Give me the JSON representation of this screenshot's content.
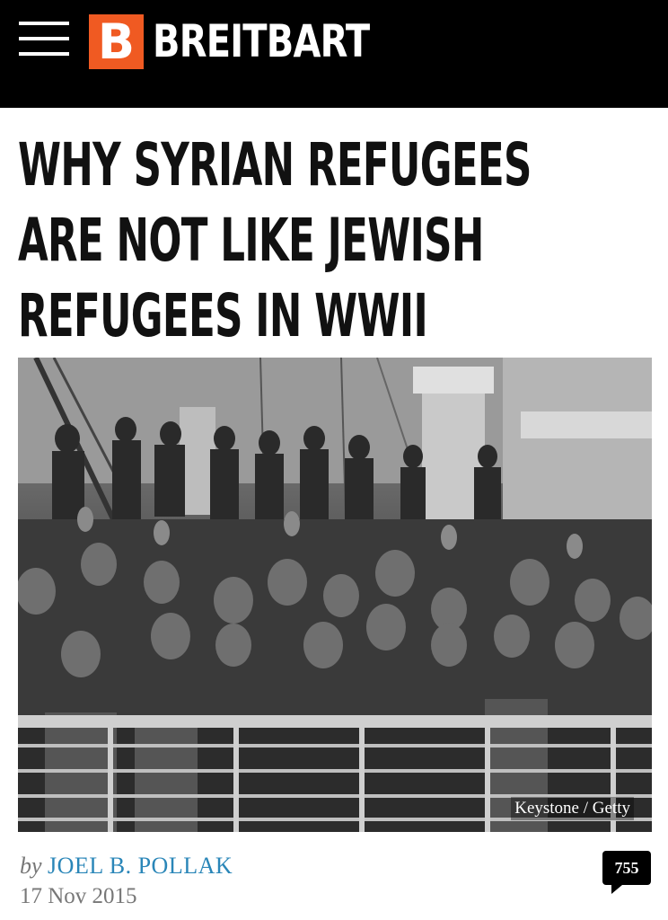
{
  "header": {
    "menu_icon": "hamburger-menu-icon",
    "logo_letter": "B",
    "logo_text": "BREITBART",
    "logo_color": "#f05a22"
  },
  "article": {
    "headline_lines": [
      "WHY SYRIAN REFUGEES",
      "ARE NOT LIKE JEWISH",
      "REFUGEES IN WWII"
    ],
    "image_credit": "Keystone / Getty",
    "byline_prefix": "by",
    "author": "JOEL B. POLLAK",
    "author_color": "#2a86b8",
    "date": "17 Nov 2015",
    "comment_count": "755"
  }
}
